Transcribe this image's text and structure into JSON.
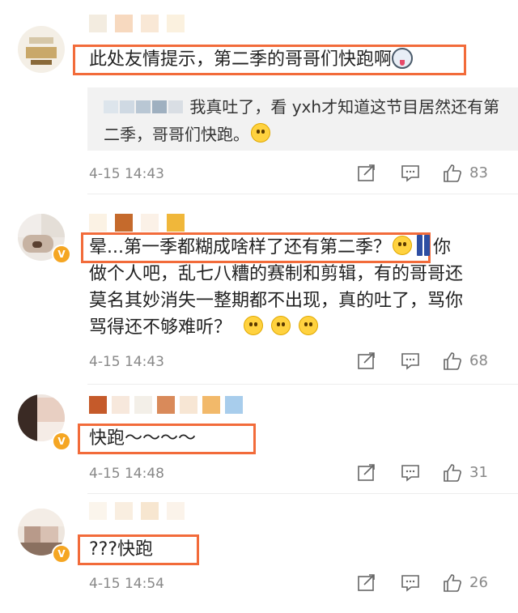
{
  "comments": [
    {
      "text": "此处友情提示，第二季的哥哥们快跑啊",
      "reply": {
        "text": "我真吐了，看 yxh才知道这节目居然还有第二季，哥哥们快跑。"
      },
      "time": "4-15 14:43",
      "likes": "83"
    },
    {
      "text_a": "晕...第一季都糊成啥样了还有第二季？",
      "text_b": "你",
      "line2": "做个人吧，乱七八糟的赛制和剪辑，有的哥哥还",
      "line3": "莫名其妙消失一整期都不出现，真的吐了，骂你",
      "line4": "骂得还不够难听？",
      "time": "4-15 14:43",
      "likes": "68"
    },
    {
      "text": "快跑～～～～",
      "time": "4-15 14:48",
      "likes": "31"
    },
    {
      "text": "???快跑",
      "time": "4-15 14:54",
      "likes": "26"
    }
  ],
  "colors": {
    "highlight": "#f26b3a",
    "verified": "#f5a623",
    "muted": "#888888"
  },
  "icons": {
    "share": "share-icon",
    "comment": "comment-icon",
    "like": "thumbs-up-icon"
  }
}
